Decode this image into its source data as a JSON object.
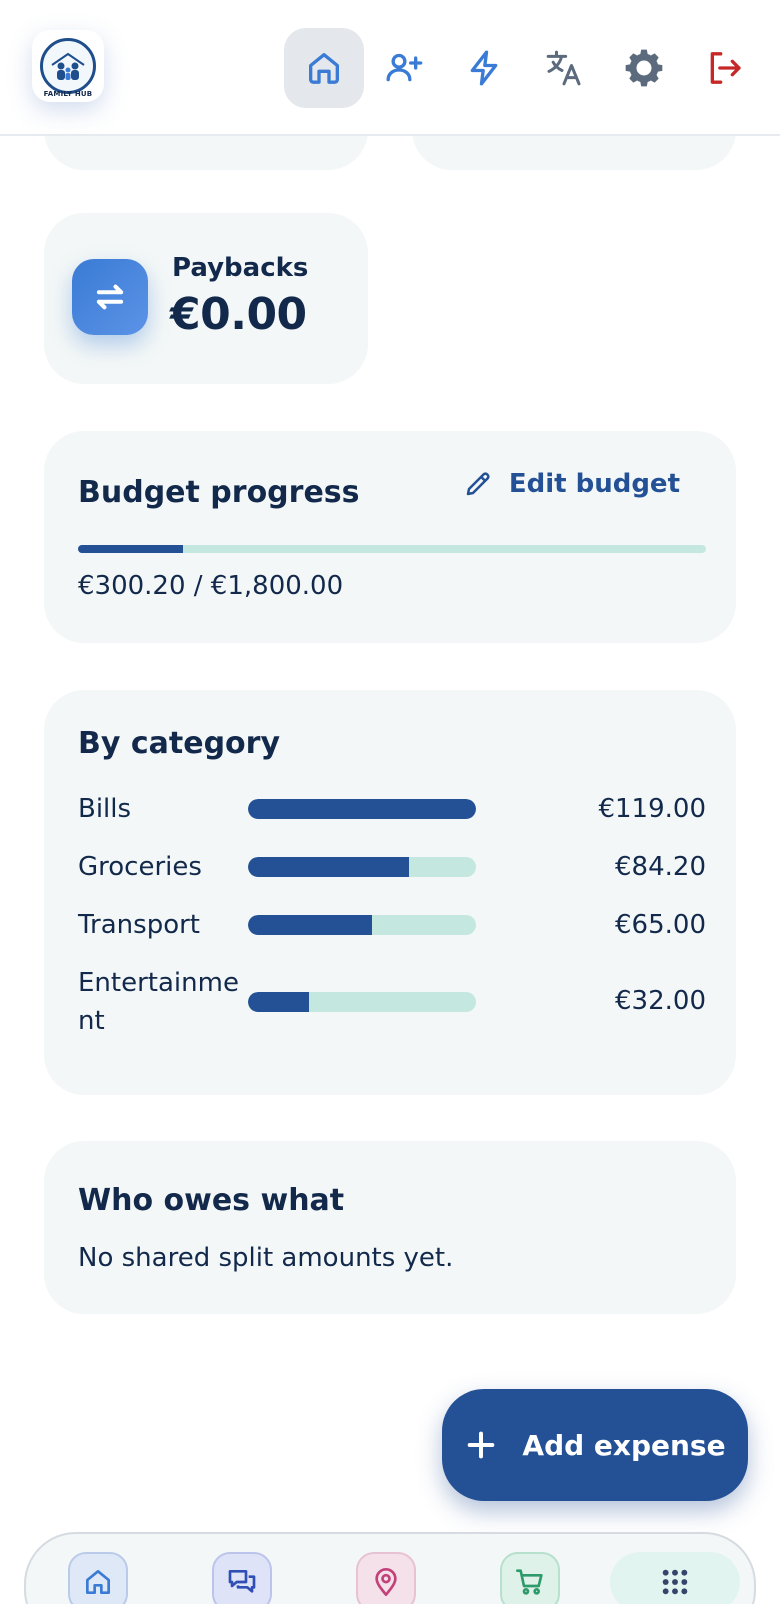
{
  "header": {
    "logo_text": "FAMILY HUB",
    "nav": [
      "home-icon",
      "add-user-icon",
      "lightning-icon",
      "translate-icon",
      "gear-icon",
      "logout-icon"
    ],
    "accent_color": "#3a7bd5",
    "logout_color": "#c62828"
  },
  "paybacks": {
    "label": "Paybacks",
    "value": "€0.00"
  },
  "budget": {
    "title": "Budget progress",
    "edit_label": "Edit budget",
    "progress_text": "€300.20 / €1,800.00",
    "spent": 300.2,
    "total": 1800.0
  },
  "category": {
    "title": "By category",
    "items": [
      {
        "name": "Bills",
        "amount": "€119.00",
        "fraction": 1.0
      },
      {
        "name": "Groceries",
        "amount": "€84.20",
        "fraction": 0.708
      },
      {
        "name": "Transport",
        "amount": "€65.00",
        "fraction": 0.546
      },
      {
        "name": "Entertainment",
        "amount": "€32.00",
        "fraction": 0.269
      }
    ]
  },
  "owes": {
    "title": "Who owes what",
    "empty_text": "No shared split amounts yet."
  },
  "fab": {
    "label": "Add expense"
  },
  "bottom_nav": [
    "home-icon",
    "chat-icon",
    "location-pin-icon",
    "cart-icon",
    "apps-grid-icon"
  ]
}
